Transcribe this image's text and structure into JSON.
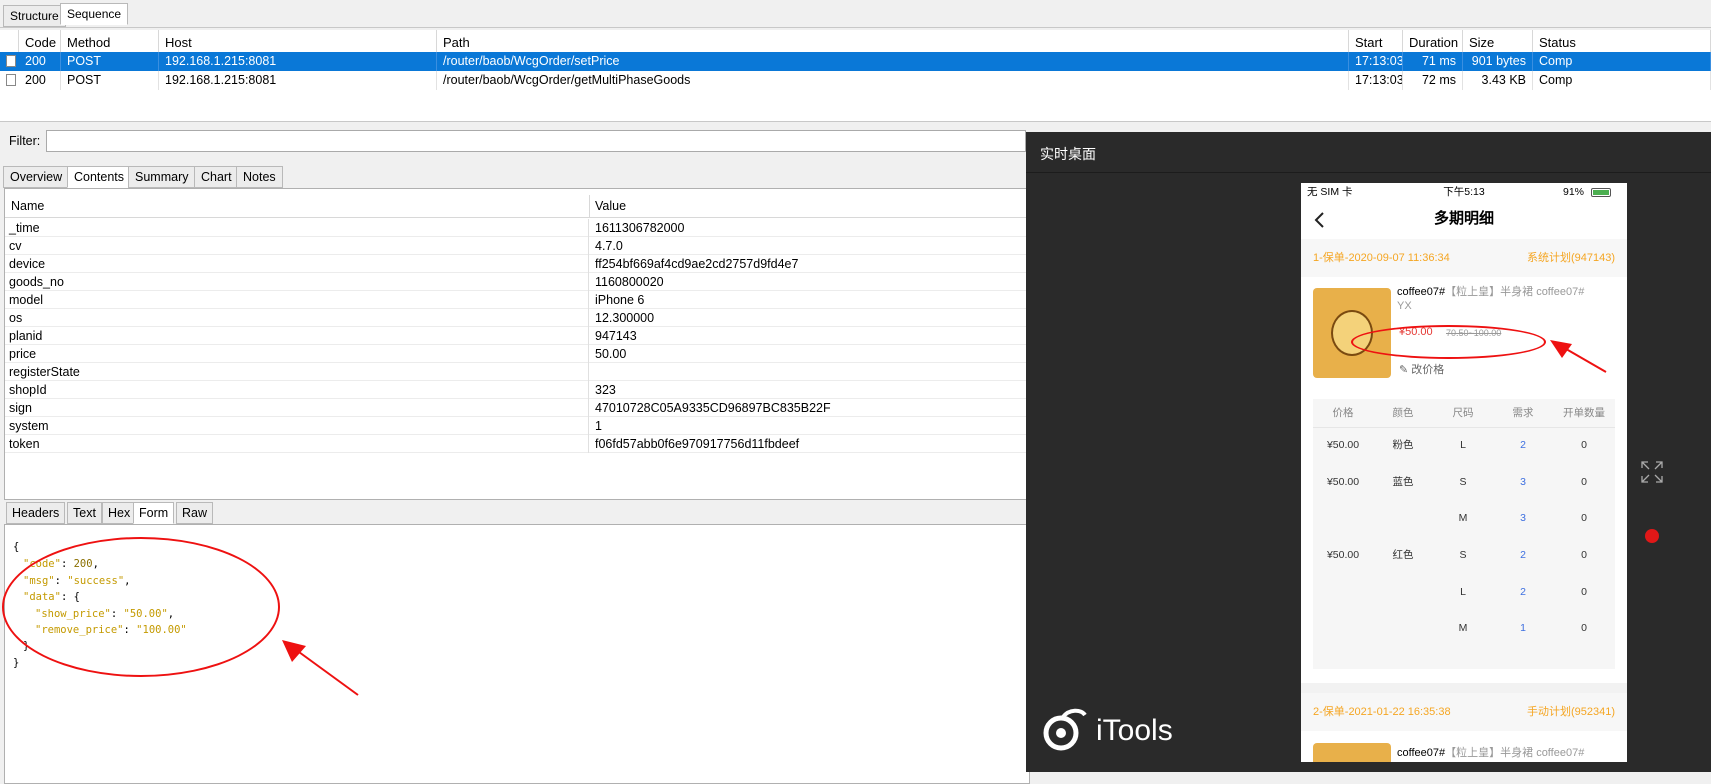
{
  "top_tabs": [
    "Structure",
    "Sequence"
  ],
  "grid": {
    "headers": [
      "Code",
      "Method",
      "Host",
      "Path",
      "Start",
      "Duration",
      "Size",
      "Status"
    ],
    "rows": [
      {
        "code": "200",
        "method": "POST",
        "host": "192.168.1.215:8081",
        "path": "/router/baob/WcgOrder/setPrice",
        "start": "17:13:03",
        "duration": "71 ms",
        "size": "901 bytes",
        "status": "Comp"
      },
      {
        "code": "200",
        "method": "POST",
        "host": "192.168.1.215:8081",
        "path": "/router/baob/WcgOrder/getMultiPhaseGoods",
        "start": "17:13:03",
        "duration": "72 ms",
        "size": "3.43 KB",
        "status": "Comp"
      }
    ]
  },
  "filter_label": "Filter:",
  "sub_tabs": [
    "Overview",
    "Contents",
    "Summary",
    "Chart",
    "Notes"
  ],
  "kv": {
    "name_header": "Name",
    "value_header": "Value",
    "rows": [
      {
        "k": "_time",
        "v": "1611306782000"
      },
      {
        "k": "cv",
        "v": "4.7.0"
      },
      {
        "k": "device",
        "v": "ff254bf669af4cd9ae2cd2757d9fd4e7"
      },
      {
        "k": "goods_no",
        "v": "1160800020"
      },
      {
        "k": "model",
        "v": "iPhone 6"
      },
      {
        "k": "os",
        "v": "12.300000"
      },
      {
        "k": "planid",
        "v": "947143"
      },
      {
        "k": "price",
        "v": "50.00"
      },
      {
        "k": "registerState",
        "v": ""
      },
      {
        "k": "shopId",
        "v": "323"
      },
      {
        "k": "sign",
        "v": "47010728C05A9335CD96897BC835B22F"
      },
      {
        "k": "system",
        "v": "1"
      },
      {
        "k": "token",
        "v": "f06fd57abb0f6e970917756d11fbdeef"
      }
    ]
  },
  "bottom_tabs": [
    "Headers",
    "Text",
    "Hex",
    "Form",
    "Raw"
  ],
  "json_view": {
    "l1": "{",
    "code_key": "\"code\"",
    "code_val": "200",
    "msg_key": "\"msg\"",
    "msg_val": "\"success\"",
    "data_key": "\"data\"",
    "show_key": "\"show_price\"",
    "show_val": "\"50.00\"",
    "remove_key": "\"remove_price\"",
    "remove_val": "\"100.00\"",
    "close_inner": "}",
    "close_outer": "}"
  },
  "overlay": {
    "title": "实时桌面",
    "brand": "iTools",
    "phone": {
      "carrier": "无 SIM 卡",
      "time": "下午5:13",
      "battery": "91%",
      "nav_title": "多期明细",
      "section1_left": "1-保单-2020-09-07 11:36:34",
      "section1_right": "系统计划(947143)",
      "product_name": "coffee07#",
      "product_tag": "【粒上皇】半身裙",
      "product_sub": "coffee07#",
      "product_yx": "YX",
      "price_now": "¥50.00",
      "price_old": "70.50~100.00",
      "edit_price": "改价格",
      "table_headers": [
        "价格",
        "颜色",
        "尺码",
        "需求",
        "开单数量"
      ],
      "table_rows": [
        {
          "price": "¥50.00",
          "color": "粉色",
          "size": "L",
          "need": "2",
          "qty": "0"
        },
        {
          "price": "¥50.00",
          "color": "蓝色",
          "size": "S",
          "need": "3",
          "qty": "0"
        },
        {
          "price": "",
          "color": "",
          "size": "M",
          "need": "3",
          "qty": "0"
        },
        {
          "price": "¥50.00",
          "color": "红色",
          "size": "S",
          "need": "2",
          "qty": "0"
        },
        {
          "price": "",
          "color": "",
          "size": "L",
          "need": "2",
          "qty": "0"
        },
        {
          "price": "",
          "color": "",
          "size": "M",
          "need": "1",
          "qty": "0"
        }
      ],
      "section2_left": "2-保单-2021-01-22 16:35:38",
      "section2_right": "手动计划(952341)",
      "product2_name": "coffee07#",
      "product2_tag": "【粒上皇】半身裙",
      "product2_sub": "coffee07#"
    }
  }
}
